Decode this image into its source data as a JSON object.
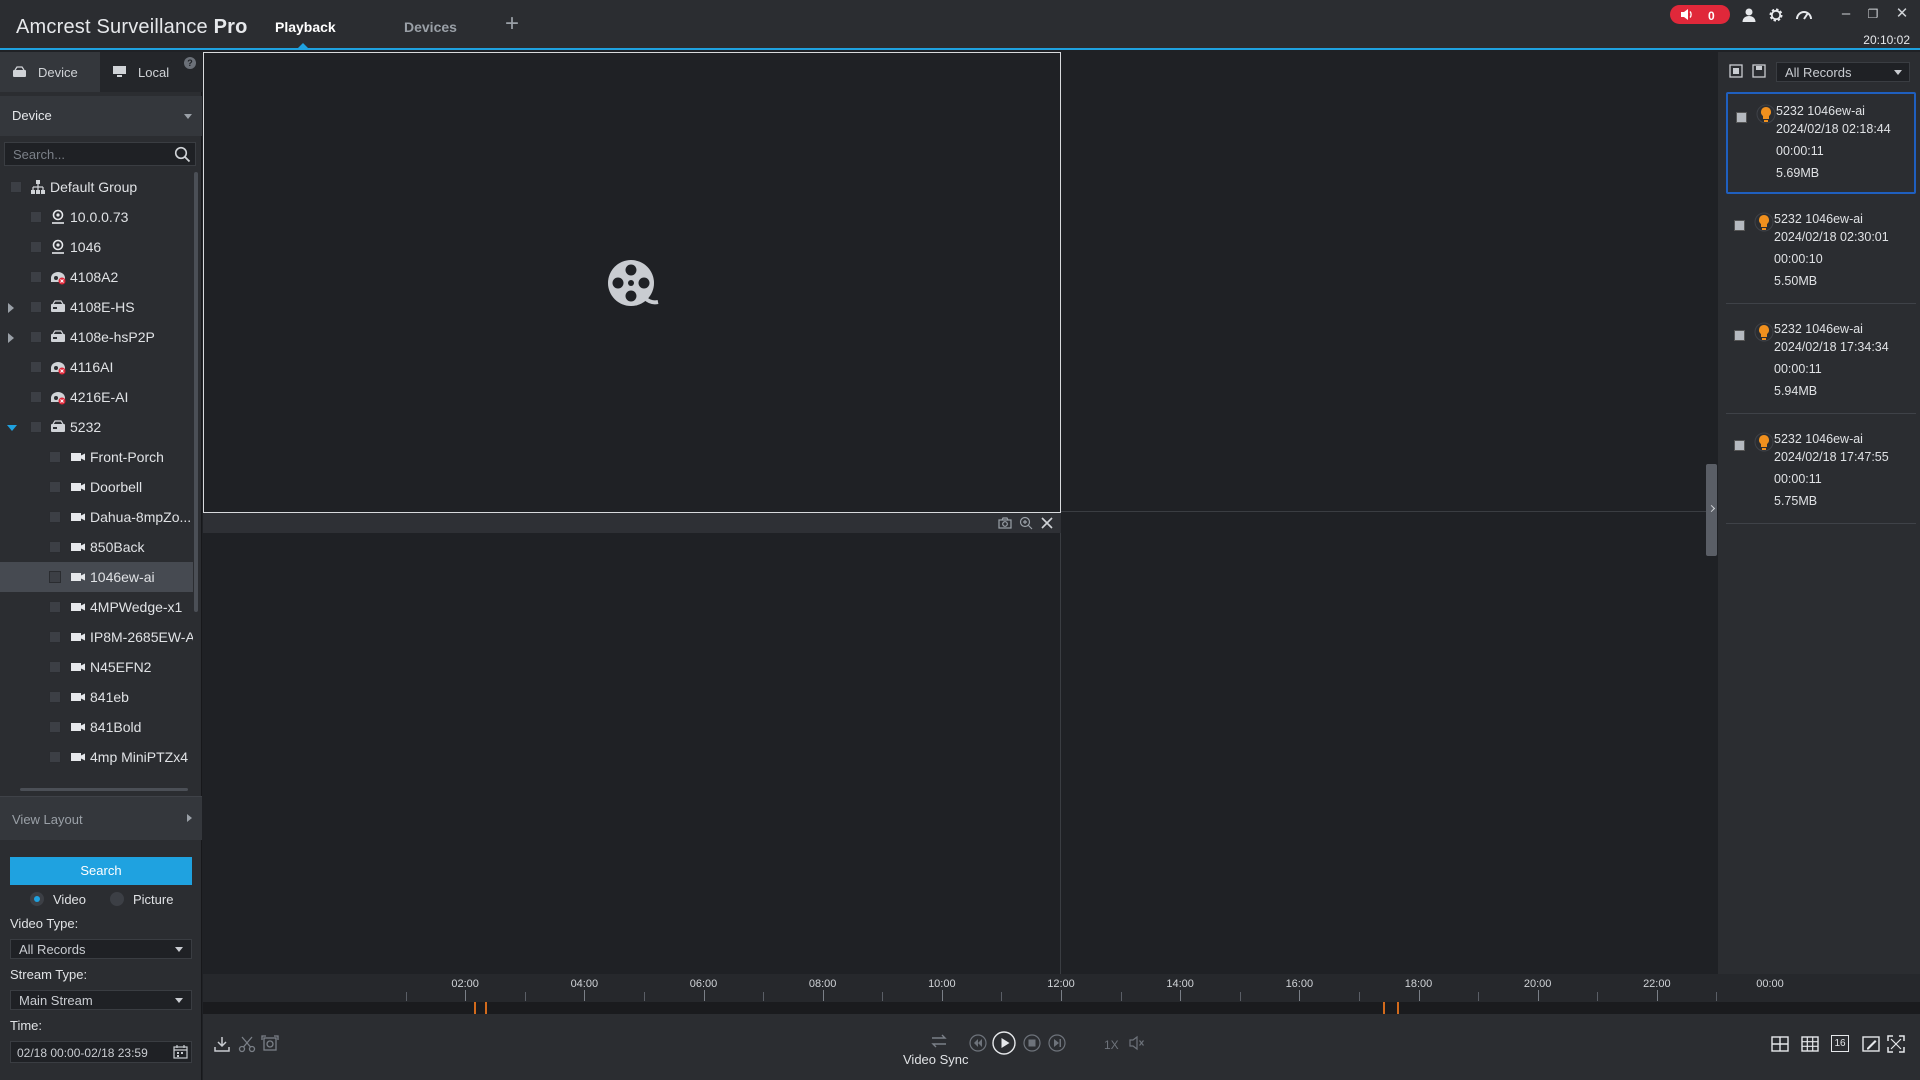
{
  "app": {
    "title_light": "Amcrest Surveillance",
    "title_bold": "Pro",
    "tabs": [
      {
        "label": "Playback",
        "active": true
      },
      {
        "label": "Devices",
        "active": false
      }
    ],
    "add_tab_icon": "plus-icon",
    "alarm_count": "0",
    "clock": "20:10:02"
  },
  "sidebar": {
    "tabs": [
      {
        "label": "Device",
        "icon": "device-icon",
        "active": true
      },
      {
        "label": "Local",
        "icon": "monitor-icon",
        "active": false
      }
    ],
    "help_label": "?",
    "device_filter": "Device",
    "search_placeholder": "Search...",
    "tree": [
      {
        "label": "Default Group",
        "icon": "group-icon",
        "level": 0,
        "expander": "none"
      },
      {
        "label": "10.0.0.73",
        "icon": "location-icon",
        "level": 1,
        "expander": "none"
      },
      {
        "label": "1046",
        "icon": "location-icon",
        "level": 1,
        "expander": "none"
      },
      {
        "label": "4108A2",
        "icon": "offline-device-icon",
        "level": 1,
        "expander": "none"
      },
      {
        "label": "4108E-HS",
        "icon": "nvr-icon",
        "level": 1,
        "expander": "collapsed"
      },
      {
        "label": "4108e-hsP2P",
        "icon": "nvr-icon",
        "level": 1,
        "expander": "collapsed"
      },
      {
        "label": "4116AI",
        "icon": "offline-device-icon",
        "level": 1,
        "expander": "none"
      },
      {
        "label": "4216E-AI",
        "icon": "offline-device-icon",
        "level": 1,
        "expander": "none"
      },
      {
        "label": "5232",
        "icon": "nvr-icon",
        "level": 1,
        "expander": "expanded"
      },
      {
        "label": "Front-Porch",
        "icon": "camera-icon",
        "level": 2,
        "expander": "none"
      },
      {
        "label": "Doorbell",
        "icon": "camera-icon",
        "level": 2,
        "expander": "none"
      },
      {
        "label": "Dahua-8mpZo...",
        "icon": "camera-icon",
        "level": 2,
        "expander": "none"
      },
      {
        "label": "850Back",
        "icon": "camera-icon",
        "level": 2,
        "expander": "none"
      },
      {
        "label": "1046ew-ai",
        "icon": "camera-icon",
        "level": 2,
        "expander": "none",
        "selected": true
      },
      {
        "label": "4MPWedge-x1",
        "icon": "camera-icon",
        "level": 2,
        "expander": "none"
      },
      {
        "label": "IP8M-2685EW-A",
        "icon": "camera-icon",
        "level": 2,
        "expander": "none"
      },
      {
        "label": "N45EFN2",
        "icon": "camera-icon",
        "level": 2,
        "expander": "none"
      },
      {
        "label": "841eb",
        "icon": "camera-icon",
        "level": 2,
        "expander": "none"
      },
      {
        "label": "841Bold",
        "icon": "camera-icon",
        "level": 2,
        "expander": "none"
      },
      {
        "label": "4mp MiniPTZx4",
        "icon": "camera-icon",
        "level": 2,
        "expander": "none"
      }
    ],
    "view_layout_label": "View Layout",
    "search_button": "Search",
    "record_kind": {
      "video_label": "Video",
      "picture_label": "Picture",
      "selected": "Video"
    },
    "video_type_label": "Video Type:",
    "video_type_value": "All Records",
    "stream_type_label": "Stream Type:",
    "stream_type_value": "Main Stream",
    "time_label": "Time:",
    "time_value": "02/18 00:00-02/18 23:59"
  },
  "records_panel": {
    "filter_value": "All Records",
    "records": [
      {
        "name": "5232 1046ew-ai",
        "datetime": "2024/02/18 02:18:44",
        "duration": "00:00:11",
        "size": "5.69MB",
        "selected": true
      },
      {
        "name": "5232 1046ew-ai",
        "datetime": "2024/02/18 02:30:01",
        "duration": "00:00:10",
        "size": "5.50MB",
        "selected": false
      },
      {
        "name": "5232 1046ew-ai",
        "datetime": "2024/02/18 17:34:34",
        "duration": "00:00:11",
        "size": "5.94MB",
        "selected": false
      },
      {
        "name": "5232 1046ew-ai",
        "datetime": "2024/02/18 17:47:55",
        "duration": "00:00:11",
        "size": "5.75MB",
        "selected": false
      }
    ]
  },
  "timeline": {
    "labels": [
      "02:00",
      "04:00",
      "06:00",
      "08:00",
      "10:00",
      "12:00",
      "14:00",
      "16:00",
      "18:00",
      "20:00",
      "22:00",
      "00:00"
    ],
    "record_times_hours": [
      2.31,
      2.5,
      17.58,
      17.8
    ],
    "range_hours": [
      0,
      24
    ]
  },
  "playback_controls": {
    "video_sync_label": "Video Sync",
    "speed_label": "1X",
    "icons": [
      "download-icon",
      "clip-icon",
      "snapshot-area-icon",
      "sync-icon",
      "rewind-icon",
      "play-icon",
      "stop-icon",
      "step-forward-icon",
      "mute-icon",
      "layout-4-icon",
      "layout-9-icon",
      "layout-16-icon",
      "edit-layout-icon",
      "fullscreen-icon"
    ],
    "layout_16_label": "16"
  },
  "colors": {
    "accent": "#1fa2e0",
    "alarm": "#e0283a",
    "record_marker": "#d26a1c",
    "selected_record_border": "#1f5fbf"
  }
}
